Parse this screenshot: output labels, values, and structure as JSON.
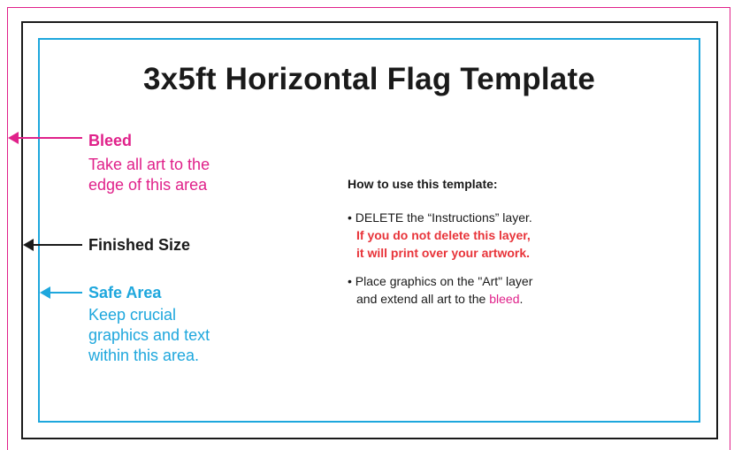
{
  "title": "3x5ft Horizontal Flag Template",
  "labels": {
    "bleed": {
      "heading": "Bleed",
      "line1": "Take all art to the",
      "line2": "edge of this area"
    },
    "finished": {
      "heading": "Finished Size"
    },
    "safe": {
      "heading": "Safe Area",
      "line1": "Keep crucial",
      "line2": "graphics and text",
      "line3": "within this area."
    }
  },
  "instructions": {
    "heading": "How to use this template:",
    "step1": "• DELETE the “Instructions” layer.",
    "warning_line1": "If you do not delete this layer,",
    "warning_line2": "it will print over your artwork.",
    "step2_line1": "• Place graphics on the \"Art\" layer",
    "step2_line2_prefix": "and extend all art to the ",
    "step2_bleed_word": "bleed",
    "step2_line2_suffix": "."
  },
  "colors": {
    "bleed": "#e0218a",
    "finished": "#1a1a1a",
    "safe": "#1ea7dd",
    "warning": "#e8343a"
  }
}
